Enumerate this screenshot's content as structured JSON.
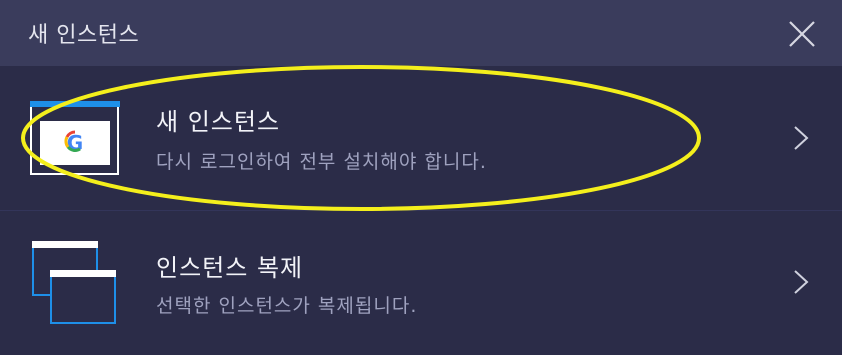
{
  "dialog": {
    "title": "새 인스턴스",
    "close_icon": "close-icon"
  },
  "options": [
    {
      "title": "새 인스턴스",
      "subtitle": "다시 로그인하여 전부 설치해야 합니다.",
      "icon": "new-instance-google-icon",
      "highlighted": true
    },
    {
      "title": "인스턴스 복제",
      "subtitle": "선택한 인스턴스가 복제됩니다.",
      "icon": "clone-instance-icon"
    }
  ],
  "colors": {
    "background": "#2b2c48",
    "titlebar": "#3a3c5c",
    "accent_blue": "#1e8fe8",
    "highlight_ring": "#f4ef1c"
  }
}
